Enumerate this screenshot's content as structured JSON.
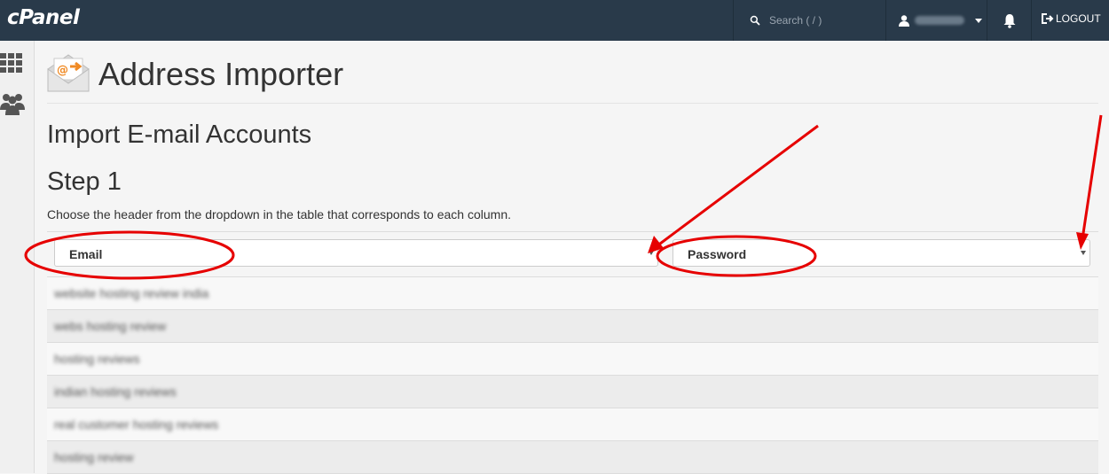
{
  "brand": {
    "logo": "cPanel"
  },
  "topbar": {
    "search_placeholder": "Search ( / )",
    "username": "sathwesh",
    "logout_label": "LOGOUT"
  },
  "page": {
    "title": "Address Importer",
    "section_title": "Import E-mail Accounts",
    "step_title": "Step 1",
    "instructions": "Choose the header from the dropdown in the table that corresponds to each column."
  },
  "table": {
    "columns": [
      {
        "selected": "Email"
      },
      {
        "selected": "Password"
      }
    ],
    "rows": [
      "website hosting review india",
      "webs hosting review",
      "hosting reviews",
      "indian hosting reviews",
      "real customer hosting reviews",
      "hosting review"
    ]
  },
  "colors": {
    "topbar": "#293a4a",
    "annotation": "#e60000",
    "icon_accent": "#f08a24"
  },
  "icons": [
    "search-icon",
    "user-icon",
    "bell-icon",
    "logout-icon",
    "grid-icon",
    "users-icon",
    "mail-import-icon"
  ]
}
